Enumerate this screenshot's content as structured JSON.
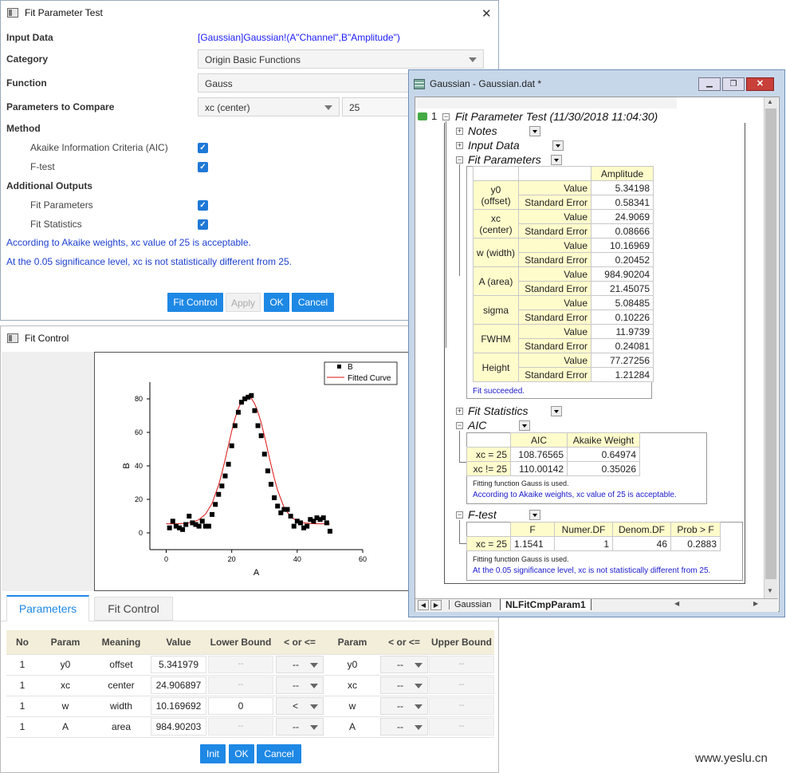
{
  "fpt": {
    "title": "Fit Parameter Test",
    "input_label": "Input Data",
    "input_value": "[Gaussian]Gaussian!(A\"Channel\",B\"Amplitude\")",
    "category_label": "Category",
    "category_value": "Origin Basic Functions",
    "function_label": "Function",
    "function_value": "Gauss",
    "params_label": "Parameters to Compare",
    "params_value": "xc (center)",
    "params_num": "25",
    "method_label": "Method",
    "aic_label": "Akaike Information Criteria (AIC)",
    "ftest_label": "F-test",
    "addout_label": "Additional Outputs",
    "fitparams_label": "Fit Parameters",
    "fitstats_label": "Fit Statistics",
    "msg1": "According to Akaike weights, xc value of 25 is acceptable.",
    "msg2": "At the 0.05 significance level, xc is not statistically different from 25.",
    "btn_fitcontrol": "Fit Control",
    "btn_apply": "Apply",
    "btn_ok": "OK",
    "btn_cancel": "Cancel",
    "close": "✕"
  },
  "fc": {
    "title": "Fit Control",
    "tab1": "Parameters",
    "tab2": "Fit Control",
    "headers": [
      "No",
      "Param",
      "Meaning",
      "Value",
      "Lower Bound",
      "< or <=",
      "Param",
      "< or <=",
      "Upper Bound"
    ],
    "rows": [
      {
        "no": "1",
        "param": "y0",
        "meaning": "offset",
        "value": "5.341979",
        "lb": "--",
        "op1": "--",
        "param2": "y0",
        "op2": "--",
        "ub": "--"
      },
      {
        "no": "1",
        "param": "xc",
        "meaning": "center",
        "value": "24.906897",
        "lb": "--",
        "op1": "--",
        "param2": "xc",
        "op2": "--",
        "ub": "--"
      },
      {
        "no": "1",
        "param": "w",
        "meaning": "width",
        "value": "10.169692",
        "lb": "0",
        "op1": "<",
        "param2": "w",
        "op2": "--",
        "ub": "--"
      },
      {
        "no": "1",
        "param": "A",
        "meaning": "area",
        "value": "984.90203",
        "lb": "--",
        "op1": "--",
        "param2": "A",
        "op2": "--",
        "ub": "--"
      }
    ],
    "btn_init": "Init",
    "btn_ok": "OK",
    "btn_cancel": "Cancel"
  },
  "chart_data": {
    "type": "scatter",
    "xlabel": "A",
    "ylabel": "B",
    "xlim": [
      -5,
      60
    ],
    "ylim": [
      -10,
      90
    ],
    "xticks": [
      0,
      20,
      40,
      60
    ],
    "yticks": [
      0,
      20,
      40,
      60,
      80
    ],
    "legend": [
      "B",
      "Fitted Curve"
    ],
    "legend_placement": "top-right",
    "series": [
      {
        "name": "B",
        "x": [
          1,
          2,
          3,
          4,
          5,
          6,
          7,
          8,
          9,
          10,
          11,
          12,
          13,
          14,
          15,
          16,
          17,
          18,
          19,
          20,
          21,
          22,
          23,
          24,
          25,
          26,
          27,
          28,
          29,
          30,
          31,
          32,
          33,
          34,
          35,
          36,
          37,
          38,
          39,
          40,
          41,
          42,
          43,
          44,
          45,
          46,
          47,
          48,
          49,
          50
        ],
        "y": [
          3,
          7,
          4,
          3,
          2,
          5,
          10,
          6,
          5,
          4,
          7,
          4,
          4,
          11,
          17,
          23,
          28,
          34,
          41,
          52,
          64,
          72,
          78,
          80,
          81,
          82,
          73,
          64,
          58,
          47,
          37,
          29,
          21,
          16,
          12,
          14,
          14,
          10,
          4,
          7,
          6,
          3,
          4,
          8,
          7,
          9,
          8,
          9,
          6,
          1
        ]
      },
      {
        "name": "Fitted Curve",
        "x": [
          0,
          2,
          4,
          6,
          8,
          10,
          12,
          14,
          16,
          17,
          18,
          19,
          20,
          21,
          22,
          23,
          24,
          25,
          26,
          27,
          28,
          29,
          30,
          31,
          32,
          33,
          34,
          36,
          38,
          40,
          42,
          44,
          46,
          48,
          50
        ],
        "y": [
          5.4,
          5.4,
          5.5,
          5.8,
          6.4,
          7.9,
          11.2,
          17.6,
          28.6,
          35.7,
          43.8,
          52.4,
          60.8,
          68.3,
          74.2,
          78.4,
          80.9,
          81.6,
          80.3,
          77.1,
          72.2,
          65.7,
          57.8,
          49.2,
          40.6,
          32.6,
          25.5,
          15.1,
          9.6,
          7.1,
          6.0,
          5.6,
          5.4,
          5.4,
          5.3
        ]
      }
    ]
  },
  "gw": {
    "title": "Gaussian - Gaussian.dat *",
    "row_num": "1",
    "header": "Fit Parameter Test (11/30/2018 11:04:30)",
    "notes": "Notes",
    "input_data": "Input Data",
    "fit_params": "Fit Parameters",
    "col_amplitude": "Amplitude",
    "params": [
      {
        "name": "y0 (offset)",
        "value": "5.34198",
        "se": "0.58341"
      },
      {
        "name": "xc (center)",
        "value": "24.9069",
        "se": "0.08666"
      },
      {
        "name": "w (width)",
        "value": "10.16969",
        "se": "0.20452"
      },
      {
        "name": "A (area)",
        "value": "984.90204",
        "se": "21.45075"
      },
      {
        "name": "sigma",
        "value": "5.08485",
        "se": "0.10226"
      },
      {
        "name": "FWHM",
        "value": "11.9739",
        "se": "0.24081"
      },
      {
        "name": "Height",
        "value": "77.27256",
        "se": "1.21284"
      }
    ],
    "value_lbl": "Value",
    "se_lbl": "Standard Error",
    "fit_succeeded": "Fit succeeded.",
    "fit_stats": "Fit Statistics",
    "aic": "AIC",
    "aic_headers": [
      "AIC",
      "Akaike Weight"
    ],
    "aic_rows": [
      {
        "lbl": "xc = 25",
        "aic": "108.76565",
        "w": "0.64974"
      },
      {
        "lbl": "xc != 25",
        "aic": "110.00142",
        "w": "0.35026"
      }
    ],
    "aic_note": "Fitting function Gauss is used.",
    "aic_msg": "According to Akaike weights, xc value of 25 is acceptable.",
    "ftest": "F-test",
    "f_headers": [
      "F",
      "Numer.DF",
      "Denom.DF",
      "Prob > F"
    ],
    "f_row": {
      "lbl": "xc = 25",
      "f": "1.1541",
      "n": "1",
      "d": "46",
      "p": "0.2883"
    },
    "f_note": "Fitting function Gauss is used.",
    "f_msg": "At the 0.05 significance level, xc is not statistically different from 25.",
    "tab1": "Gaussian",
    "tab2": "NLFitCmpParam1"
  },
  "watermark": "www.yeslu.cn"
}
